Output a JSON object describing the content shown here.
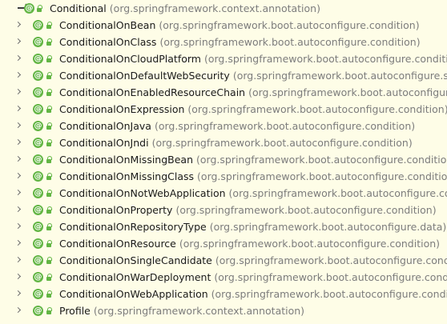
{
  "hierarchy": {
    "root": {
      "name": "Conditional",
      "package": "(org.springframework.context.annotation)"
    },
    "children": [
      {
        "name": "ConditionalOnBean",
        "package": "(org.springframework.boot.autoconfigure.condition)"
      },
      {
        "name": "ConditionalOnClass",
        "package": "(org.springframework.boot.autoconfigure.condition)"
      },
      {
        "name": "ConditionalOnCloudPlatform",
        "package": "(org.springframework.boot.autoconfigure.condition)"
      },
      {
        "name": "ConditionalOnDefaultWebSecurity",
        "package": "(org.springframework.boot.autoconfigure.securit"
      },
      {
        "name": "ConditionalOnEnabledResourceChain",
        "package": "(org.springframework.boot.autoconfigure.we"
      },
      {
        "name": "ConditionalOnExpression",
        "package": "(org.springframework.boot.autoconfigure.condition)"
      },
      {
        "name": "ConditionalOnJava",
        "package": "(org.springframework.boot.autoconfigure.condition)"
      },
      {
        "name": "ConditionalOnJndi",
        "package": "(org.springframework.boot.autoconfigure.condition)"
      },
      {
        "name": "ConditionalOnMissingBean",
        "package": "(org.springframework.boot.autoconfigure.condition)"
      },
      {
        "name": "ConditionalOnMissingClass",
        "package": "(org.springframework.boot.autoconfigure.condition)"
      },
      {
        "name": "ConditionalOnNotWebApplication",
        "package": "(org.springframework.boot.autoconfigure.conditi"
      },
      {
        "name": "ConditionalOnProperty",
        "package": "(org.springframework.boot.autoconfigure.condition)"
      },
      {
        "name": "ConditionalOnRepositoryType",
        "package": "(org.springframework.boot.autoconfigure.data)"
      },
      {
        "name": "ConditionalOnResource",
        "package": "(org.springframework.boot.autoconfigure.condition)"
      },
      {
        "name": "ConditionalOnSingleCandidate",
        "package": "(org.springframework.boot.autoconfigure.condition"
      },
      {
        "name": "ConditionalOnWarDeployment",
        "package": "(org.springframework.boot.autoconfigure.condition)"
      },
      {
        "name": "ConditionalOnWebApplication",
        "package": "(org.springframework.boot.autoconfigure.condition)"
      },
      {
        "name": "Profile",
        "package": "(org.springframework.context.annotation)"
      }
    ]
  },
  "icons": {
    "root_arrow": "arrow-right-icon",
    "expand": "chevron-right-icon",
    "annotation": "annotation-icon",
    "visibility": "public-lock-icon"
  },
  "colors": {
    "background": "#fefde7",
    "annotation_icon": "#62b543",
    "package_text": "#7c7c7c",
    "name_text": "#1a1a1a"
  }
}
